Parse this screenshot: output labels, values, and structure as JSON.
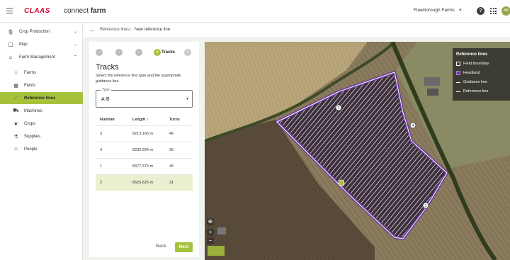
{
  "app": {
    "logo": "CLAAS",
    "name_light": "connect ",
    "name_bold": "farm"
  },
  "header": {
    "farm": "Flawborough Farms",
    "help": "?",
    "avatar": "AB"
  },
  "sidebar": {
    "crop_production": "Crop Production",
    "map": "Map",
    "farm_management": "Farm Management",
    "items": [
      "Farms",
      "Fields",
      "Reference lines",
      "Machines",
      "Crops",
      "Supplies",
      "People"
    ]
  },
  "breadcrumb": {
    "parent": "Reference lines",
    "separator": "|",
    "current": "New reference line"
  },
  "wizard": {
    "steps": [
      "✓",
      "✓",
      "✓",
      "4"
    ],
    "step_label": "Tracks",
    "last_step": "5",
    "title": "Tracks",
    "description": "Select the reference line type and the appropriate guidance line.",
    "type_label": "Type",
    "type_value": "A-B",
    "columns": [
      "Number",
      "Length ↑",
      "Turns"
    ],
    "rows": [
      {
        "number": "3",
        "length": "8213.166 m",
        "turns": "46"
      },
      {
        "number": "4",
        "length": "8282.294 m",
        "turns": "36"
      },
      {
        "number": "1",
        "length": "8377.379 m",
        "turns": "46"
      },
      {
        "number": "2",
        "length": "8625.825 m",
        "turns": "31"
      }
    ],
    "back": "Back",
    "next": "Next"
  },
  "legend": {
    "title": "Reference lines",
    "items": [
      "Field boundary",
      "Headland",
      "Guidance line",
      "Reference line"
    ],
    "colors": {
      "boundary": "#ffffff",
      "headland": "#6a3a9a",
      "guidance": "#ffffff",
      "accent": "#a6c23b"
    }
  },
  "map": {
    "markers": [
      "2",
      "4",
      "1"
    ]
  }
}
